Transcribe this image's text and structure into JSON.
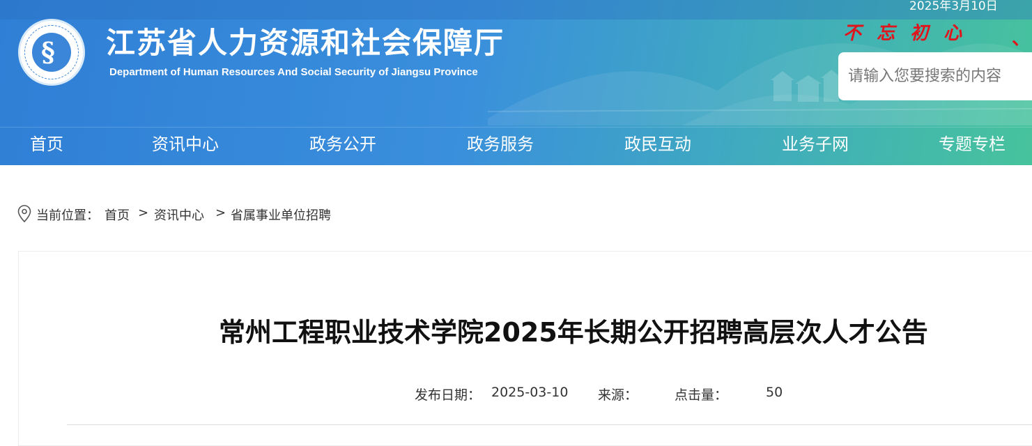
{
  "header": {
    "date": "2025年3月10日",
    "site_title": "江苏省人力资源和社会保障厅",
    "site_subtitle": "Department of Human Resources And Social Security of Jiangsu Province",
    "slogan": "不忘初心",
    "slogan_tail": "、",
    "search_placeholder": "请输入您要搜索的内容"
  },
  "nav": {
    "items": [
      {
        "label": "首页"
      },
      {
        "label": "资讯中心"
      },
      {
        "label": "政务公开"
      },
      {
        "label": "政务服务"
      },
      {
        "label": "政民互动"
      },
      {
        "label": "业务子网"
      },
      {
        "label": "专题专栏"
      }
    ]
  },
  "breadcrumb": {
    "prefix": "当前位置：",
    "items": [
      "首页",
      "资讯中心",
      "省属事业单位招聘"
    ],
    "separator": ">"
  },
  "article": {
    "title": "常州工程职业技术学院2025年长期公开招聘高层次人才公告",
    "publish_label": "发布日期：",
    "publish_date": "2025-03-10",
    "source_label": "来源：",
    "source_value": "",
    "views_label": "点击量：",
    "views_value": "50"
  },
  "colors": {
    "banner_start": "#2f7fd6",
    "banner_end": "#47c39c",
    "slogan": "#e0141b"
  }
}
